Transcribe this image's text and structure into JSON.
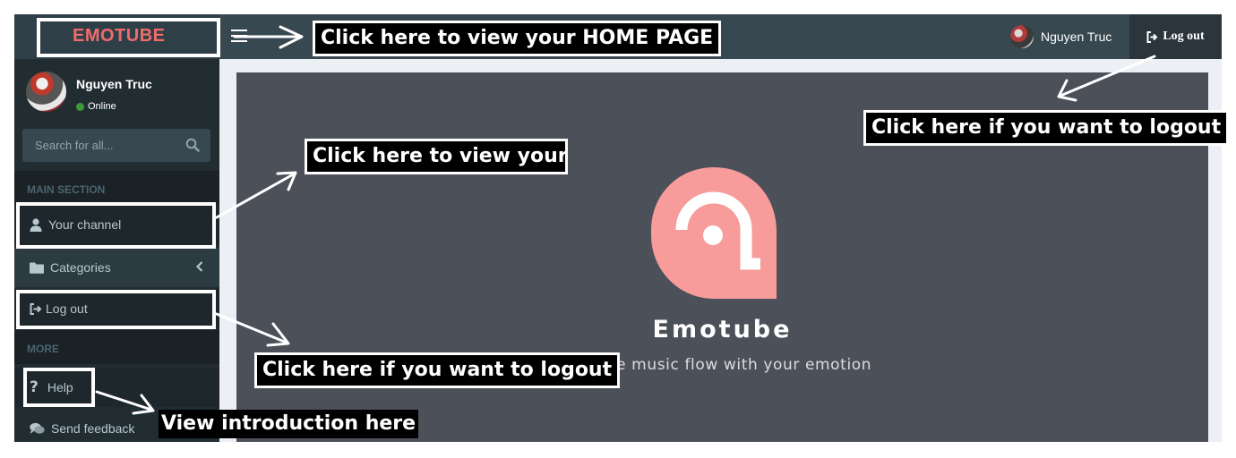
{
  "app": {
    "logo": "EMOTUBE",
    "brand_color": "#f06c6c"
  },
  "navbar": {
    "user_name": "Nguyen Truc",
    "logout_label": "Log out"
  },
  "sidebar": {
    "user": {
      "name": "Nguyen Truc",
      "status": "Online"
    },
    "search": {
      "placeholder": "Search for all..."
    },
    "main_header": "MAIN SECTION",
    "items": [
      {
        "label": "Your channel",
        "icon": "user-icon"
      },
      {
        "label": "Categories",
        "icon": "folder-icon"
      },
      {
        "label": "Log out",
        "icon": "sign-out-icon"
      }
    ],
    "more_header": "MORE",
    "more_items": [
      {
        "label": "Help",
        "icon": "question-icon"
      },
      {
        "label": "Send feedback",
        "icon": "comments-icon"
      }
    ]
  },
  "content": {
    "brand_name": "Emotube",
    "tagline": "Make music flow with your emotion"
  },
  "annotations": {
    "home": "Click here to view your HOME PAGE",
    "logout_top": "Click here if you want to logout",
    "channel": "Click here to view your",
    "logout_side": "Click here if you want to logout",
    "help": "View introduction here"
  }
}
